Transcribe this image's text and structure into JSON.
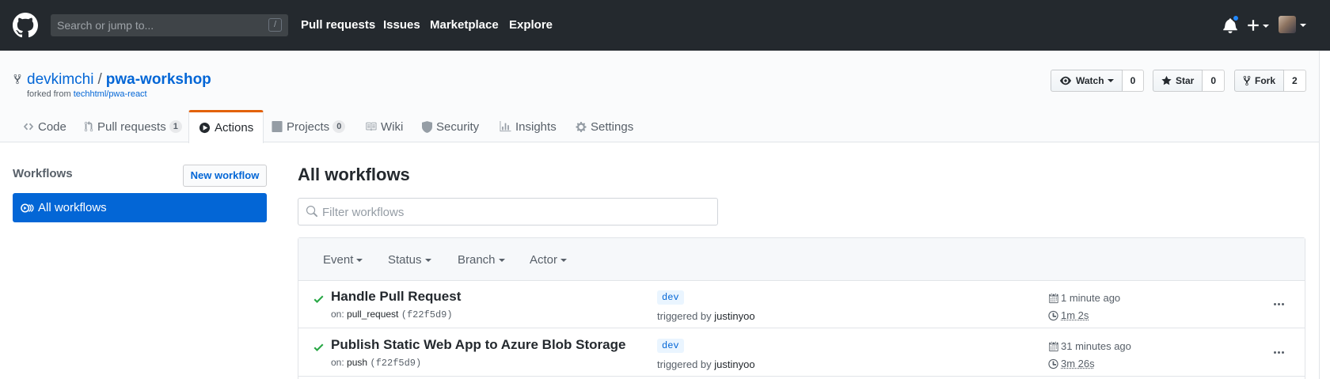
{
  "header": {
    "search_placeholder": "Search or jump to...",
    "search_shortcut": "/",
    "nav": [
      "Pull requests",
      "Issues",
      "Marketplace",
      "Explore"
    ]
  },
  "repo": {
    "owner": "devkimchi",
    "separator": "/",
    "name": "pwa-workshop",
    "forked_prefix": "forked from ",
    "forked_from": "techhtml/pwa-react",
    "watch_label": "Watch",
    "watch_count": "0",
    "star_label": "Star",
    "star_count": "0",
    "fork_label": "Fork",
    "fork_count": "2"
  },
  "tabs": {
    "code": "Code",
    "pull_requests": "Pull requests",
    "pull_requests_count": "1",
    "actions": "Actions",
    "projects": "Projects",
    "projects_count": "0",
    "wiki": "Wiki",
    "security": "Security",
    "insights": "Insights",
    "settings": "Settings",
    "selected": "actions"
  },
  "sidebar": {
    "title": "Workflows",
    "new_workflow": "New workflow",
    "all_workflows": "All workflows"
  },
  "main": {
    "title": "All workflows",
    "filter_placeholder": "Filter workflows",
    "filters": [
      "Event",
      "Status",
      "Branch",
      "Actor"
    ],
    "runs": [
      {
        "status": "success",
        "title": "Handle Pull Request",
        "on_prefix": "on: ",
        "event": "pull_request",
        "sha": "(f22f5d9)",
        "branch": "dev",
        "triggered_prefix": "triggered by ",
        "actor": "justinyoo",
        "time": "1 minute ago",
        "duration": "1m 2s"
      },
      {
        "status": "success",
        "title": "Publish Static Web App to Azure Blob Storage",
        "on_prefix": "on: ",
        "event": "push",
        "sha": "(f22f5d9)",
        "branch": "dev",
        "triggered_prefix": "triggered by ",
        "actor": "justinyoo",
        "time": "31 minutes ago",
        "duration": "3m 26s"
      }
    ]
  },
  "colors": {
    "header_bg": "#24292e",
    "link": "#0366d6",
    "selected_tab_accent": "#e36209",
    "success": "#28a745",
    "notification_dot": "#2188ff"
  }
}
